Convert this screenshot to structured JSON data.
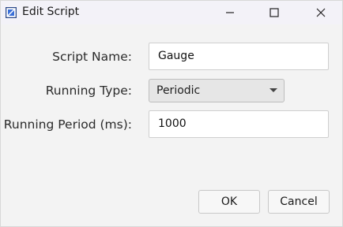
{
  "window": {
    "title": "Edit Script",
    "icon": "app-icon",
    "controls": [
      "minimize-icon",
      "maximize-icon",
      "close-icon"
    ]
  },
  "form": {
    "script_name_label": "Script Name:",
    "script_name_value": "Gauge",
    "running_type_label": "Running Type:",
    "running_type_value": "Periodic",
    "running_period_label": "Running Period (ms):",
    "running_period_value": "1000"
  },
  "buttons": {
    "ok_label": "OK",
    "cancel_label": "Cancel"
  }
}
